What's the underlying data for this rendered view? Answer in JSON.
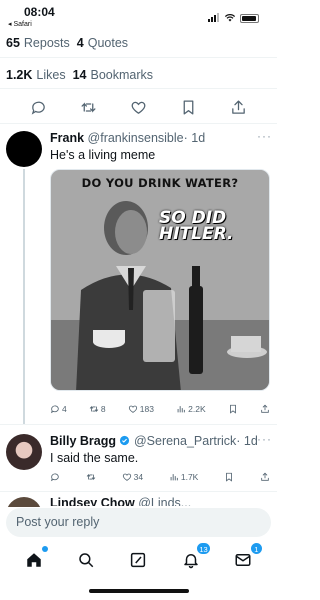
{
  "status_bar": {
    "time": "08:04",
    "back_label": "◂ Safari"
  },
  "stats": {
    "reposts_count": "65",
    "reposts_label": "Reposts",
    "quotes_count": "4",
    "quotes_label": "Quotes",
    "likes_count": "1.2K",
    "likes_label": "Likes",
    "bookmarks_count": "14",
    "bookmarks_label": "Bookmarks"
  },
  "reply1": {
    "name": "Frank",
    "handle": "@frankinsensible",
    "time": "· 1d",
    "text": "He's a living meme",
    "meme_top": "DO YOU DRINK WATER?",
    "meme_right": "SO DID HITLER.",
    "metrics": {
      "replies": "4",
      "reposts": "8",
      "likes": "183",
      "views": "2.2K"
    }
  },
  "reply2": {
    "name": "Billy Bragg",
    "handle": "@Serena_Partrick",
    "time": "· 1d",
    "text": "I said the same.",
    "metrics": {
      "reposts": "",
      "likes": "34",
      "views": "1.7K"
    }
  },
  "reply3": {
    "name": "Lindsey Chow",
    "handle": "@Linds..."
  },
  "composer": {
    "placeholder": "Post your reply"
  },
  "nav": {
    "notifications_badge": "13",
    "messages_badge": "1"
  },
  "colors": {
    "accent": "#1d9bf0",
    "verified": "#1d9bf0",
    "muted": "#536471"
  }
}
